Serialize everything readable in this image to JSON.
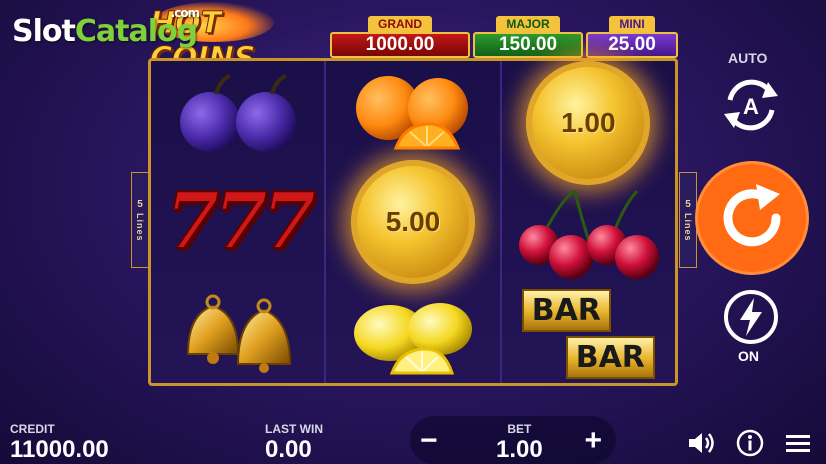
{
  "watermark": {
    "part1": "Slot",
    "part2": "Catalog",
    "suffix": ".com"
  },
  "logo": {
    "text": "HOT COINS"
  },
  "jackpots": [
    {
      "label": "GRAND",
      "value": "1000.00",
      "color": "#c21818"
    },
    {
      "label": "MAJOR",
      "value": "150.00",
      "color": "#2c9a2c"
    },
    {
      "label": "MINI",
      "value": "25.00",
      "color": "#7a3ad0"
    }
  ],
  "lines": {
    "count": "5",
    "word": "Lines"
  },
  "reels": [
    [
      "plum-pair",
      "seven-triple",
      "bell-pair"
    ],
    [
      "orange-pair",
      "coin",
      "lemon-pair"
    ],
    [
      "coin",
      "cherry-triple",
      "bar-double"
    ]
  ],
  "coins": {
    "reel2_row2": "5.00",
    "reel3_row1": "1.00"
  },
  "bar_symbol": {
    "top": "BAR",
    "bottom": "BAR"
  },
  "seven_text": "777",
  "controls": {
    "auto_label": "AUTO",
    "turbo_label": "ON",
    "spin_color": "#ff6a12"
  },
  "bottom": {
    "credit_label": "CREDIT",
    "credit_value": "11000.00",
    "lastwin_label": "LAST WIN",
    "lastwin_value": "0.00",
    "bet_label": "BET",
    "bet_value": "1.00",
    "minus": "−",
    "plus": "+"
  }
}
